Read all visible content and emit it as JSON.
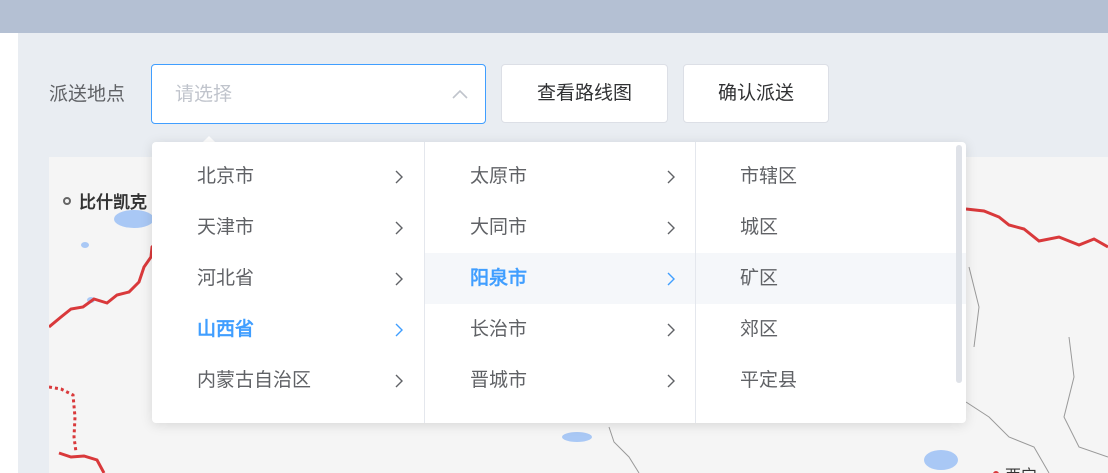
{
  "form": {
    "label": "派送地点",
    "select_placeholder": "请选择",
    "view_route_button": "查看路线图",
    "confirm_button": "确认派送"
  },
  "map": {
    "legend_text": "比什凯克",
    "city_label": "西宁"
  },
  "cascader": {
    "provinces": [
      {
        "label": "北京市"
      },
      {
        "label": "天津市"
      },
      {
        "label": "河北省"
      },
      {
        "label": "山西省"
      },
      {
        "label": "内蒙古自治区"
      }
    ],
    "cities": [
      {
        "label": "太原市"
      },
      {
        "label": "大同市"
      },
      {
        "label": "阳泉市"
      },
      {
        "label": "长治市"
      },
      {
        "label": "晋城市"
      }
    ],
    "districts": [
      {
        "label": "市辖区"
      },
      {
        "label": "城区"
      },
      {
        "label": "矿区"
      },
      {
        "label": "郊区"
      },
      {
        "label": "平定县"
      }
    ],
    "active_province": "山西省",
    "active_city": "阳泉市"
  },
  "colors": {
    "accent": "#409eff",
    "border": "#red-line-not-used",
    "route_red": "#d9393b"
  }
}
